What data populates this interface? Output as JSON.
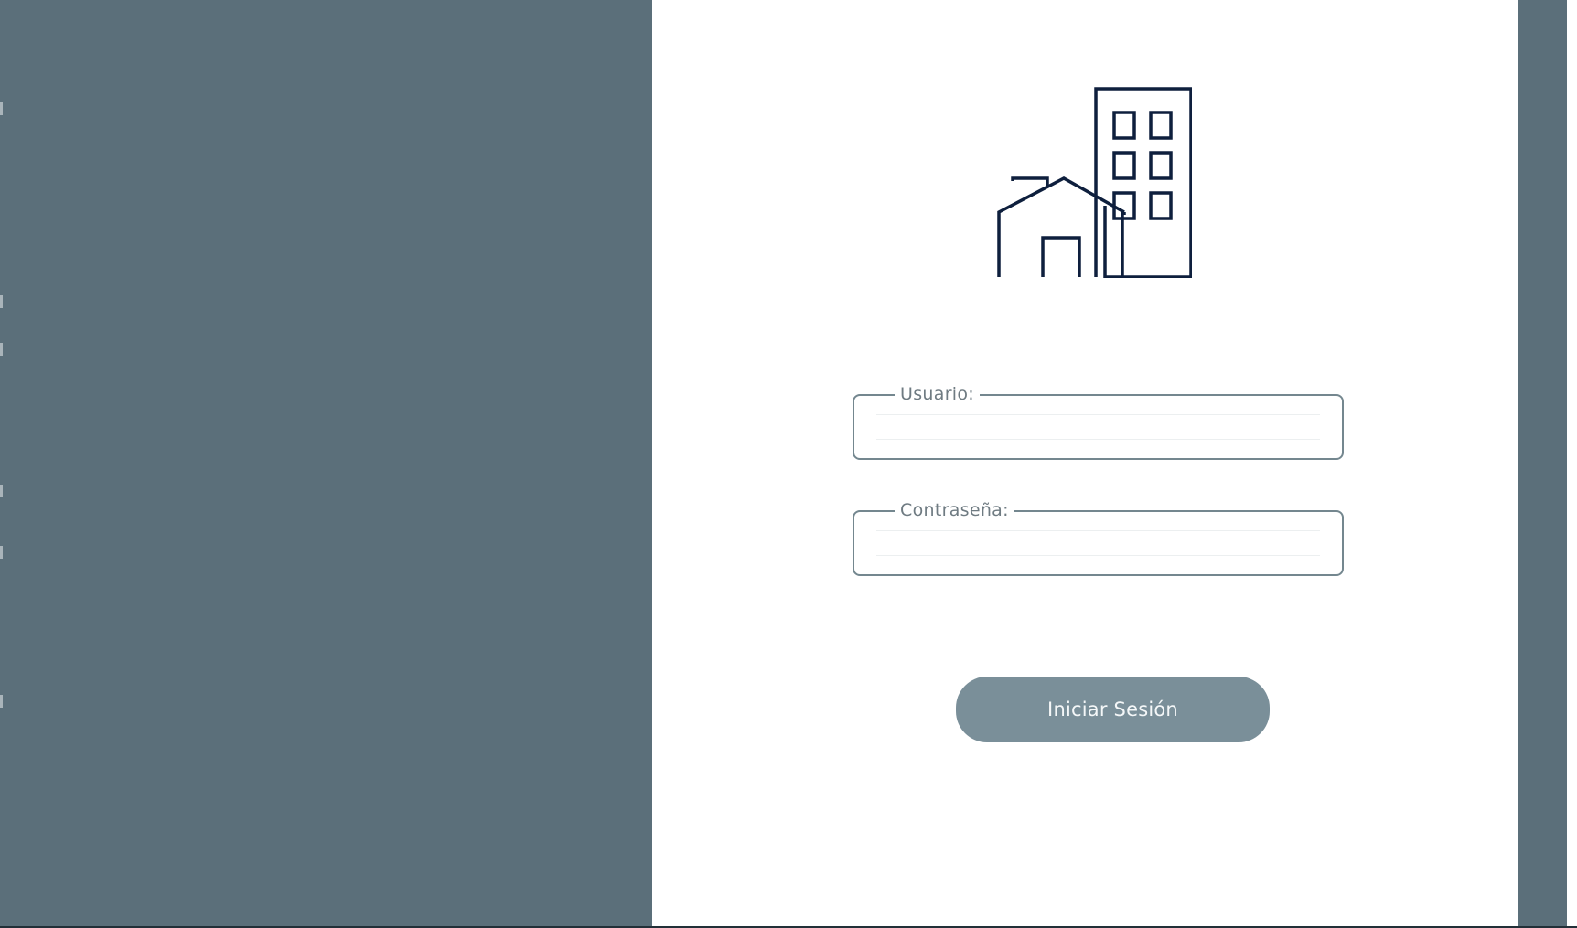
{
  "login": {
    "logo_icon": "building-house-icon",
    "username": {
      "label": "Usuario:",
      "value": ""
    },
    "password": {
      "label": "Contraseña:",
      "value": ""
    },
    "submit_label": "Iniciar Sesión"
  },
  "colors": {
    "side_panel": "#5b6f7a",
    "background": "#ffffff",
    "logo_stroke": "#0e1f3d",
    "field_border": "#74878f",
    "label_text": "#6f7b82",
    "button_bg": "#7a8f99",
    "button_text": "#f4f7f8"
  }
}
